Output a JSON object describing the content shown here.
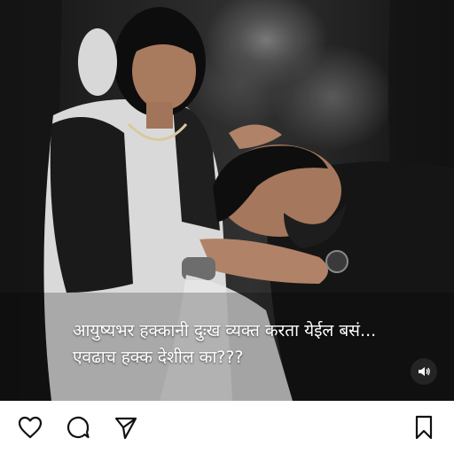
{
  "post": {
    "caption_line1": "आयुष्यभर हक्कानी दुःख व्यक्त करता येईल बसं...",
    "caption_line2": "एवढाच हक्क देशील का???",
    "audio_icon": "speaker-icon"
  },
  "actions": {
    "like_icon": "heart-icon",
    "comment_icon": "comment-icon",
    "share_icon": "paper-plane-icon",
    "save_icon": "bookmark-icon"
  }
}
